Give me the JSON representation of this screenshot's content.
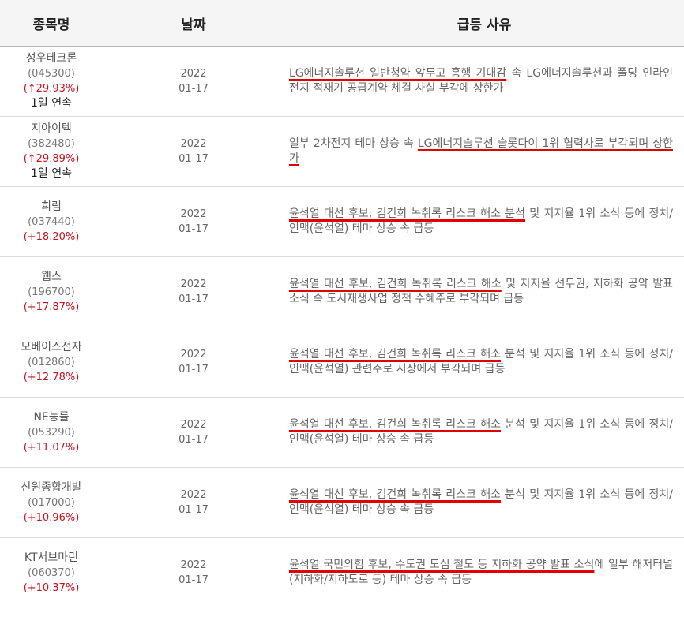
{
  "header": {
    "col_name": "종목명",
    "col_date": "날짜",
    "col_reason": "급등 사유"
  },
  "rows": [
    {
      "name": "성우테크론",
      "code": "(045300)",
      "rate": "(↑29.93%)",
      "streak": "1일 연속",
      "year": "2022",
      "date": "01-17",
      "reason_hl": "LG에너지솔루션 일반청약 앞두고 흥행 기대감",
      "reason_rest": " 속 LG에너지솔루션과 폴딩 인라인 전지 적재기 공급계약 체결 사실 부각에 상한가"
    },
    {
      "name": "지아이텍",
      "code": "(382480)",
      "rate": "(↑29.89%)",
      "streak": "1일 연속",
      "year": "2022",
      "date": "01-17",
      "reason_pre": "일부 2차전지 테마 상승 속 ",
      "reason_hl": "LG에너지솔루션 슬롯다이 1위 협력사로 부각되며 상한가",
      "reason_rest": ""
    },
    {
      "name": "희림",
      "code": "(037440)",
      "rate": "(+18.20%)",
      "streak": "",
      "year": "2022",
      "date": "01-17",
      "reason_hl": "윤석열 대선 후보, 김건희 녹취록 리스크 해소 분석",
      "reason_rest": " 및 지지율 1위 소식 등에 정치/인맥(윤석열) 테마 상승 속 급등"
    },
    {
      "name": "웹스",
      "code": "(196700)",
      "rate": "(+17.87%)",
      "streak": "",
      "year": "2022",
      "date": "01-17",
      "reason_hl": "윤석열 대선 후보, 김건희 녹취록 리스크 해소",
      "reason_rest": " 및 지지율 선두권, 지하화 공약 발표 소식 속 도시재생사업 정책 수혜주로 부각되며 급등"
    },
    {
      "name": "모베이스전자",
      "code": "(012860)",
      "rate": "(+12.78%)",
      "streak": "",
      "year": "2022",
      "date": "01-17",
      "reason_hl": "윤석열 대선 후보, 김건희 녹취록 리스크 해소",
      "reason_rest": " 분석 및 지지율 1위 소식 등에 정치/인맥(윤석열) 관련주로 시장에서 부각되며 급등"
    },
    {
      "name": "NE능률",
      "code": "(053290)",
      "rate": "(+11.07%)",
      "streak": "",
      "year": "2022",
      "date": "01-17",
      "reason_hl": "윤석열 대선 후보, 김건희 녹취록 리스크 해소",
      "reason_rest": " 분석 및 지지율 1위 소식 등에 정치/인맥(윤석열) 테마 상승 속 급등"
    },
    {
      "name": "신원종합개발",
      "code": "(017000)",
      "rate": "(+10.96%)",
      "streak": "",
      "year": "2022",
      "date": "01-17",
      "reason_hl": "윤석열 대선 후보, 김건희 녹취록 리스크 해소",
      "reason_rest": " 분석 및 지지율 1위 소식 등에 정치/인맥(윤석열) 테마 상승 속 급등"
    },
    {
      "name": "KT서브마린",
      "code": "(060370)",
      "rate": "(+10.37%)",
      "streak": "",
      "year": "2022",
      "date": "01-17",
      "reason_hl": "윤석열 국민의힘 후보, 수도권 도심 철도 등 지하화 공약 발표 소식",
      "reason_rest": "에 일부 해저터널(지하화/지하도로 등) 테마 상승 속 급등"
    }
  ],
  "colors": {
    "rate": "#c8131e",
    "underline": "#e00000",
    "header_bg": "#f5f5f5"
  }
}
